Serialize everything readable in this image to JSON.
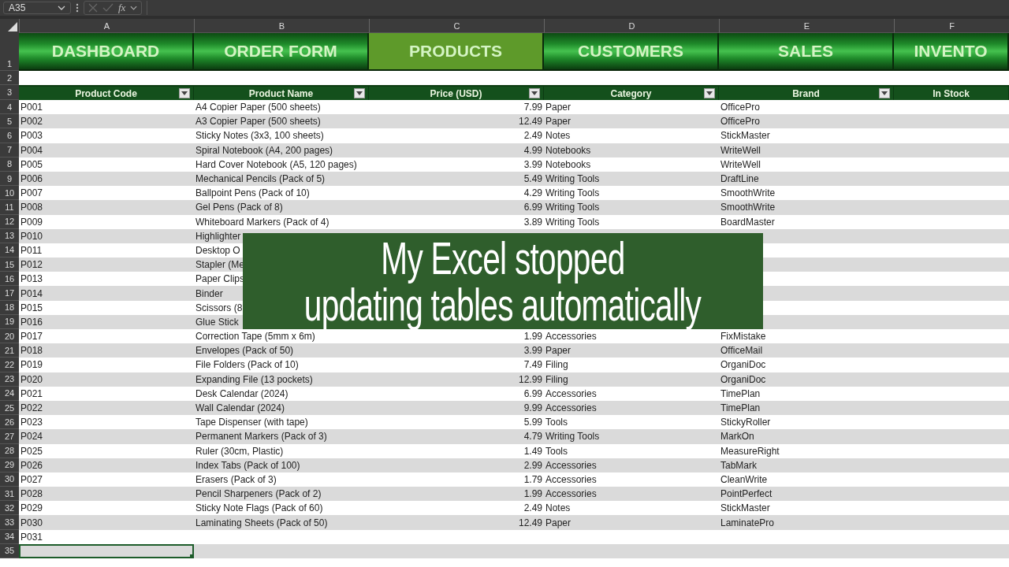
{
  "formula_bar": {
    "name_box": "A35",
    "fx": "fx"
  },
  "columns": [
    "A",
    "B",
    "C",
    "D",
    "E",
    "F"
  ],
  "top_row_numbers": [
    "1",
    "2",
    "3"
  ],
  "nav_tabs": [
    {
      "label": "DASHBOARD",
      "selected": false
    },
    {
      "label": "ORDER FORM",
      "selected": false
    },
    {
      "label": "PRODUCTS",
      "selected": true
    },
    {
      "label": "CUSTOMERS",
      "selected": false
    },
    {
      "label": "SALES",
      "selected": false
    },
    {
      "label": "INVENTO",
      "selected": false
    }
  ],
  "table_headers": [
    {
      "label": "Product Code",
      "filter": true
    },
    {
      "label": "Product Name",
      "filter": true
    },
    {
      "label": "Price (USD)",
      "filter": true
    },
    {
      "label": "Category",
      "filter": true
    },
    {
      "label": "Brand",
      "filter": true
    },
    {
      "label": "In Stock",
      "filter": false
    }
  ],
  "rows": [
    {
      "num": "4",
      "code": "P001",
      "name": "A4 Copier Paper (500 sheets)",
      "price": "7.99",
      "category": "Paper",
      "brand": "OfficePro",
      "selected": false
    },
    {
      "num": "5",
      "code": "P002",
      "name": "A3 Copier Paper (500 sheets)",
      "price": "12.49",
      "category": "Paper",
      "brand": "OfficePro",
      "selected": false
    },
    {
      "num": "6",
      "code": "P003",
      "name": "Sticky Notes (3x3, 100 sheets)",
      "price": "2.49",
      "category": "Notes",
      "brand": "StickMaster",
      "selected": false
    },
    {
      "num": "7",
      "code": "P004",
      "name": "Spiral Notebook (A4, 200 pages)",
      "price": "4.99",
      "category": "Notebooks",
      "brand": "WriteWell",
      "selected": false
    },
    {
      "num": "8",
      "code": "P005",
      "name": "Hard Cover Notebook (A5, 120 pages)",
      "price": "3.99",
      "category": "Notebooks",
      "brand": "WriteWell",
      "selected": false
    },
    {
      "num": "9",
      "code": "P006",
      "name": "Mechanical Pencils (Pack of 5)",
      "price": "5.49",
      "category": "Writing Tools",
      "brand": "DraftLine",
      "selected": false
    },
    {
      "num": "10",
      "code": "P007",
      "name": "Ballpoint Pens (Pack of 10)",
      "price": "4.29",
      "category": "Writing Tools",
      "brand": "SmoothWrite",
      "selected": false
    },
    {
      "num": "11",
      "code": "P008",
      "name": "Gel Pens (Pack of 8)",
      "price": "6.99",
      "category": "Writing Tools",
      "brand": "SmoothWrite",
      "selected": false
    },
    {
      "num": "12",
      "code": "P009",
      "name": "Whiteboard Markers (Pack of 4)",
      "price": "3.89",
      "category": "Writing Tools",
      "brand": "BoardMaster",
      "selected": false
    },
    {
      "num": "13",
      "code": "P010",
      "name": "Highlighter",
      "selected": false
    },
    {
      "num": "14",
      "code": "P011",
      "name": "Desktop O",
      "selected": false
    },
    {
      "num": "15",
      "code": "P012",
      "name": "Stapler (Me",
      "selected": false
    },
    {
      "num": "16",
      "code": "P013",
      "name": "Paper Clips",
      "selected": false
    },
    {
      "num": "17",
      "code": "P014",
      "name": "Binder",
      "selected": false
    },
    {
      "num": "18",
      "code": "P015",
      "name": "Scissors (8",
      "selected": false
    },
    {
      "num": "19",
      "code": "P016",
      "name": "Glue Stick",
      "selected": false
    },
    {
      "num": "20",
      "code": "P017",
      "name": "Correction Tape (5mm x 6m)",
      "price": "1.99",
      "category": "Accessories",
      "brand": "FixMistake",
      "selected": false
    },
    {
      "num": "21",
      "code": "P018",
      "name": "Envelopes (Pack of 50)",
      "price": "3.99",
      "category": "Paper",
      "brand": "OfficeMail",
      "selected": false
    },
    {
      "num": "22",
      "code": "P019",
      "name": "File Folders (Pack of 10)",
      "price": "7.49",
      "category": "Filing",
      "brand": "OrganiDoc",
      "selected": false
    },
    {
      "num": "23",
      "code": "P020",
      "name": "Expanding File (13 pockets)",
      "price": "12.99",
      "category": "Filing",
      "brand": "OrganiDoc",
      "selected": false
    },
    {
      "num": "24",
      "code": "P021",
      "name": "Desk Calendar (2024)",
      "price": "6.99",
      "category": "Accessories",
      "brand": "TimePlan",
      "selected": false
    },
    {
      "num": "25",
      "code": "P022",
      "name": "Wall Calendar (2024)",
      "price": "9.99",
      "category": "Accessories",
      "brand": "TimePlan",
      "selected": false
    },
    {
      "num": "26",
      "code": "P023",
      "name": "Tape Dispenser (with tape)",
      "price": "5.99",
      "category": "Tools",
      "brand": "StickyRoller",
      "selected": false
    },
    {
      "num": "27",
      "code": "P024",
      "name": "Permanent Markers (Pack of 3)",
      "price": "4.79",
      "category": "Writing Tools",
      "brand": "MarkOn",
      "selected": false
    },
    {
      "num": "28",
      "code": "P025",
      "name": "Ruler (30cm, Plastic)",
      "price": "1.49",
      "category": "Tools",
      "brand": "MeasureRight",
      "selected": false
    },
    {
      "num": "29",
      "code": "P026",
      "name": "Index Tabs (Pack of 100)",
      "price": "2.99",
      "category": "Accessories",
      "brand": "TabMark",
      "selected": false
    },
    {
      "num": "30",
      "code": "P027",
      "name": "Erasers (Pack of 3)",
      "price": "1.79",
      "category": "Accessories",
      "brand": "CleanWrite",
      "selected": false
    },
    {
      "num": "31",
      "code": "P028",
      "name": "Pencil Sharpeners (Pack of 2)",
      "price": "1.99",
      "category": "Accessories",
      "brand": "PointPerfect",
      "selected": false
    },
    {
      "num": "32",
      "code": "P029",
      "name": "Sticky Note Flags (Pack of 60)",
      "price": "2.49",
      "category": "Notes",
      "brand": "StickMaster",
      "selected": false
    },
    {
      "num": "33",
      "code": "P030",
      "name": "Laminating Sheets (Pack of 50)",
      "price": "12.49",
      "category": "Paper",
      "brand": "LaminatePro",
      "selected": false
    },
    {
      "num": "34",
      "code": "P031",
      "selected": false
    },
    {
      "num": "35",
      "selected": true
    }
  ],
  "overlay": {
    "lines": [
      "My Excel stopped",
      "updating tables automatically"
    ]
  }
}
